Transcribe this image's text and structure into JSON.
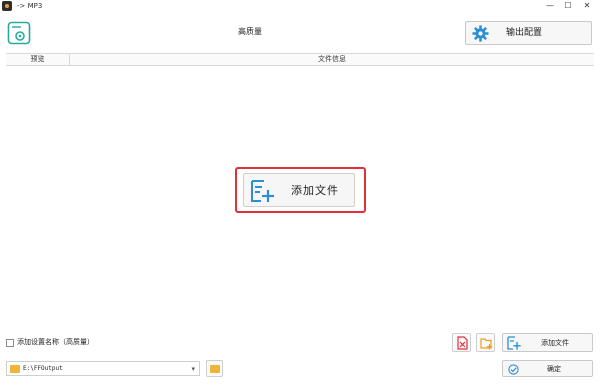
{
  "window": {
    "title": "-> MP3",
    "minimize": "—",
    "maximize": "☐",
    "close": "✕"
  },
  "header": {
    "preset_title": "高质量",
    "output_config_label": "输出配置"
  },
  "table": {
    "columns": [
      "预览",
      "文件信息"
    ]
  },
  "main": {
    "add_file_label": "添加文件"
  },
  "bottom": {
    "checkbox_label": "添加设置名称（高质量）",
    "checkbox_checked": false,
    "add_file_label": "添加文件",
    "output_path": "E:\\FFOutput",
    "ok_label": "确定"
  },
  "colors": {
    "accent": "#2a8fd4",
    "highlight": "#e0303a",
    "folder": "#f0b43a"
  },
  "icons": {
    "app": "app-icon",
    "logo": "settings-doc-icon",
    "gear": "gear-icon",
    "add_file": "add-file-icon",
    "clear": "clear-list-icon",
    "add_folder": "add-folder-icon",
    "folder": "folder-icon",
    "ok": "check-circle-icon"
  }
}
